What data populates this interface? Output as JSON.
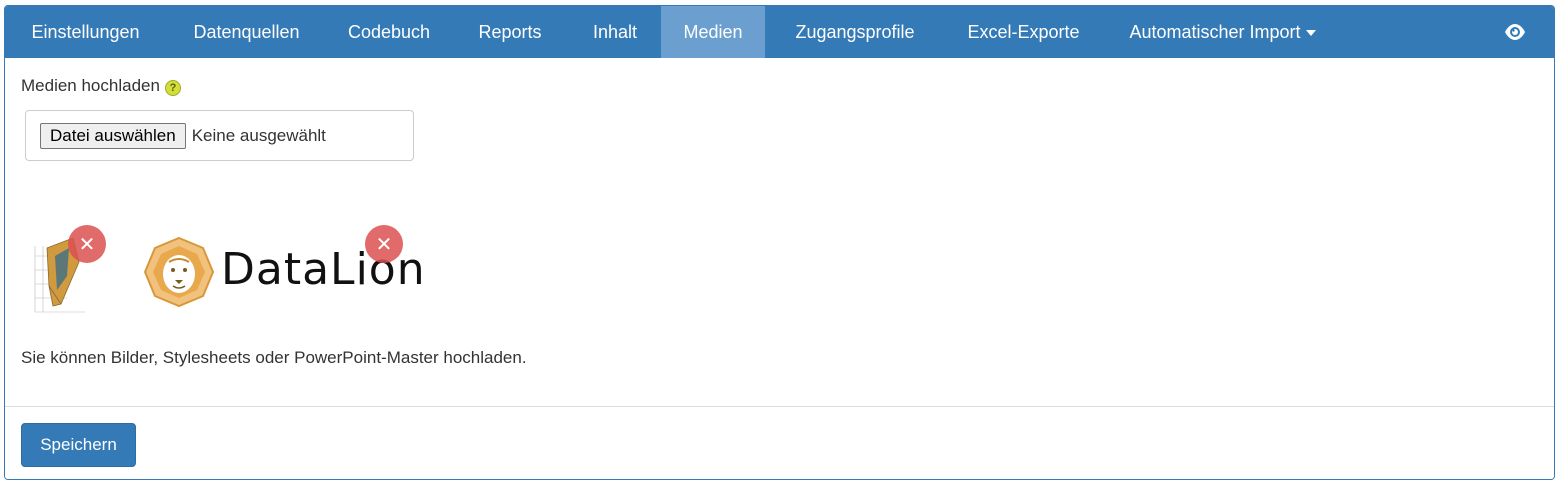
{
  "nav": {
    "tabs": [
      {
        "label": "Einstellungen"
      },
      {
        "label": "Datenquellen"
      },
      {
        "label": "Codebuch"
      },
      {
        "label": "Reports"
      },
      {
        "label": "Inhalt"
      },
      {
        "label": "Medien"
      },
      {
        "label": "Zugangsprofile"
      },
      {
        "label": "Excel-Exporte"
      },
      {
        "label": "Automatischer Import"
      }
    ],
    "active_tab": "Medien",
    "preview_icon": "eye-icon"
  },
  "upload": {
    "label": "Medien hochladen",
    "help_icon": "question-icon",
    "help_glyph": "?",
    "button_label": "Datei auswählen",
    "status": "Keine ausgewählt"
  },
  "media": {
    "remove_glyph": "✕",
    "items": [
      {
        "icon": "chart-thumbnail-icon"
      },
      {
        "icon": "lion-logo-icon",
        "brand_text": "DataLion"
      }
    ]
  },
  "info_text": "Sie können Bilder, Stylesheets oder PowerPoint-Master hochladen.",
  "footer": {
    "save_label": "Speichern"
  },
  "colors": {
    "primary": "#337ab7",
    "active_tab": "#6a9fd0",
    "remove": "#dc5050",
    "logo": "#e0a24a"
  }
}
